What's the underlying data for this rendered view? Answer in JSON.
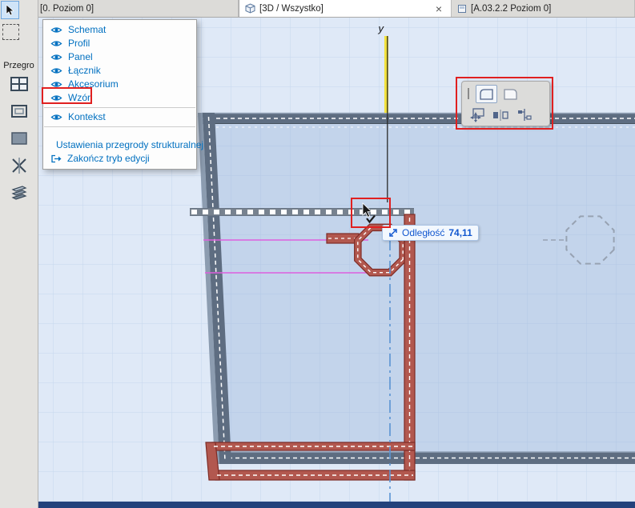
{
  "tab_bar": {
    "tabs": [
      {
        "label": "[0. Poziom 0]"
      },
      {
        "label": "[3D / Wszystko]",
        "close_glyph": "×"
      },
      {
        "label": "[A.03.2.2 Poziom 0]"
      }
    ]
  },
  "toolbox": {
    "section_label": "Przegro"
  },
  "context_menu": {
    "view_items": [
      {
        "label": "Schemat"
      },
      {
        "label": "Profil"
      },
      {
        "label": "Panel"
      },
      {
        "label": "Łącznik"
      },
      {
        "label": "Akcesorium"
      },
      {
        "label": "Wzór",
        "highlighted": true
      },
      {
        "label": "Kontekst"
      }
    ],
    "action_items": [
      {
        "label": "Ustawienia przegrody strukturalnej"
      },
      {
        "label": "Zakończ tryb edycji"
      }
    ]
  },
  "viewport": {
    "axis_label": "y",
    "tracker": {
      "label": "Odległość",
      "value": "74,11"
    }
  },
  "colors": {
    "menu_text": "#0070c0",
    "annotation_red": "#e02020",
    "selection_red": "#b2584f",
    "magenta": "#de5ede",
    "viewport_bg": "#dfe9f7",
    "tracker_text": "#1257cf",
    "frame_dark": "#5e6d81",
    "axis_yellow": "#f2e23c",
    "guide_blue": "#5a93d2"
  }
}
